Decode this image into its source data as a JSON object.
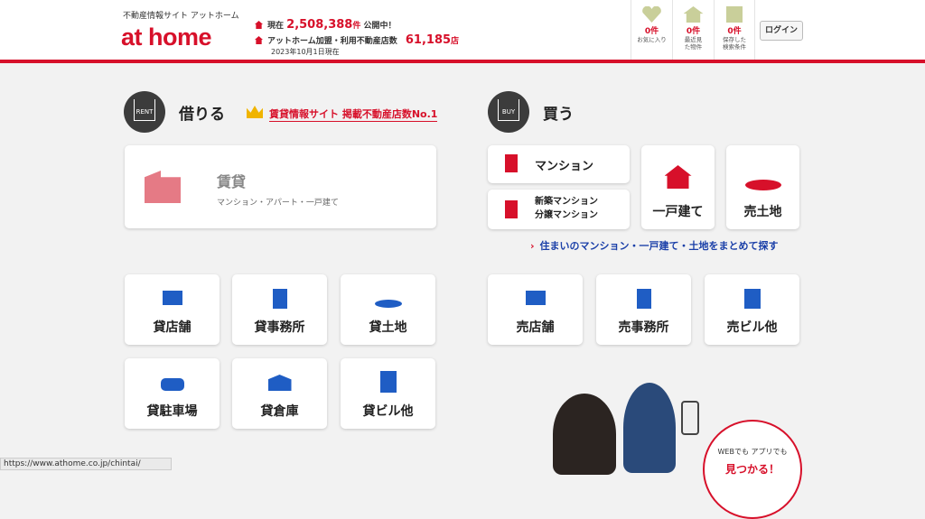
{
  "header": {
    "site_sub": "不動産情報サイト アットホーム",
    "logo": "at home",
    "stat1_pre": "現在",
    "stat1_num": "2,508,388",
    "stat1_unit": "件",
    "stat1_post": "公開中！",
    "stat2_pre": "アットホーム加盟・利用不動産店数",
    "stat2_num": "61,185",
    "stat2_unit": "店",
    "stat_date": "2023年10月1日現在",
    "icons": [
      {
        "name": "heart-icon",
        "count": "0件",
        "label": "お気に入り"
      },
      {
        "name": "house-icon",
        "count": "0件",
        "label": "最近見た物件"
      },
      {
        "name": "save-search-icon",
        "count": "0件",
        "label": "保存した検索条件"
      }
    ],
    "login": "ログイン"
  },
  "rent": {
    "badge": "RENT",
    "title": "借りる",
    "no1": "賃貸情報サイト 掲載不動産店数No.1",
    "main_title": "賃貸",
    "main_sub": "マンション・アパート・一戸建て",
    "tiles": [
      "貸店舗",
      "貸事務所",
      "貸土地",
      "貸駐車場",
      "貸倉庫",
      "貸ビル他"
    ]
  },
  "buy": {
    "badge": "BUY",
    "title": "買う",
    "mansion": "マンション",
    "new_mansion_1": "新築マンション",
    "new_mansion_2": "分譲マンション",
    "house": "一戸建て",
    "land": "売土地",
    "link_all": "住まいのマンション・一戸建て・土地をまとめて探す",
    "tiles": [
      "売店舗",
      "売事務所",
      "売ビル他"
    ]
  },
  "promo": {
    "line1": "WEBでも アプリでも",
    "line2": "見つかる！"
  },
  "status_url": "https://www.athome.co.jp/chintai/",
  "colors": {
    "brand": "#d7102a",
    "blue": "#1f5dc4"
  }
}
